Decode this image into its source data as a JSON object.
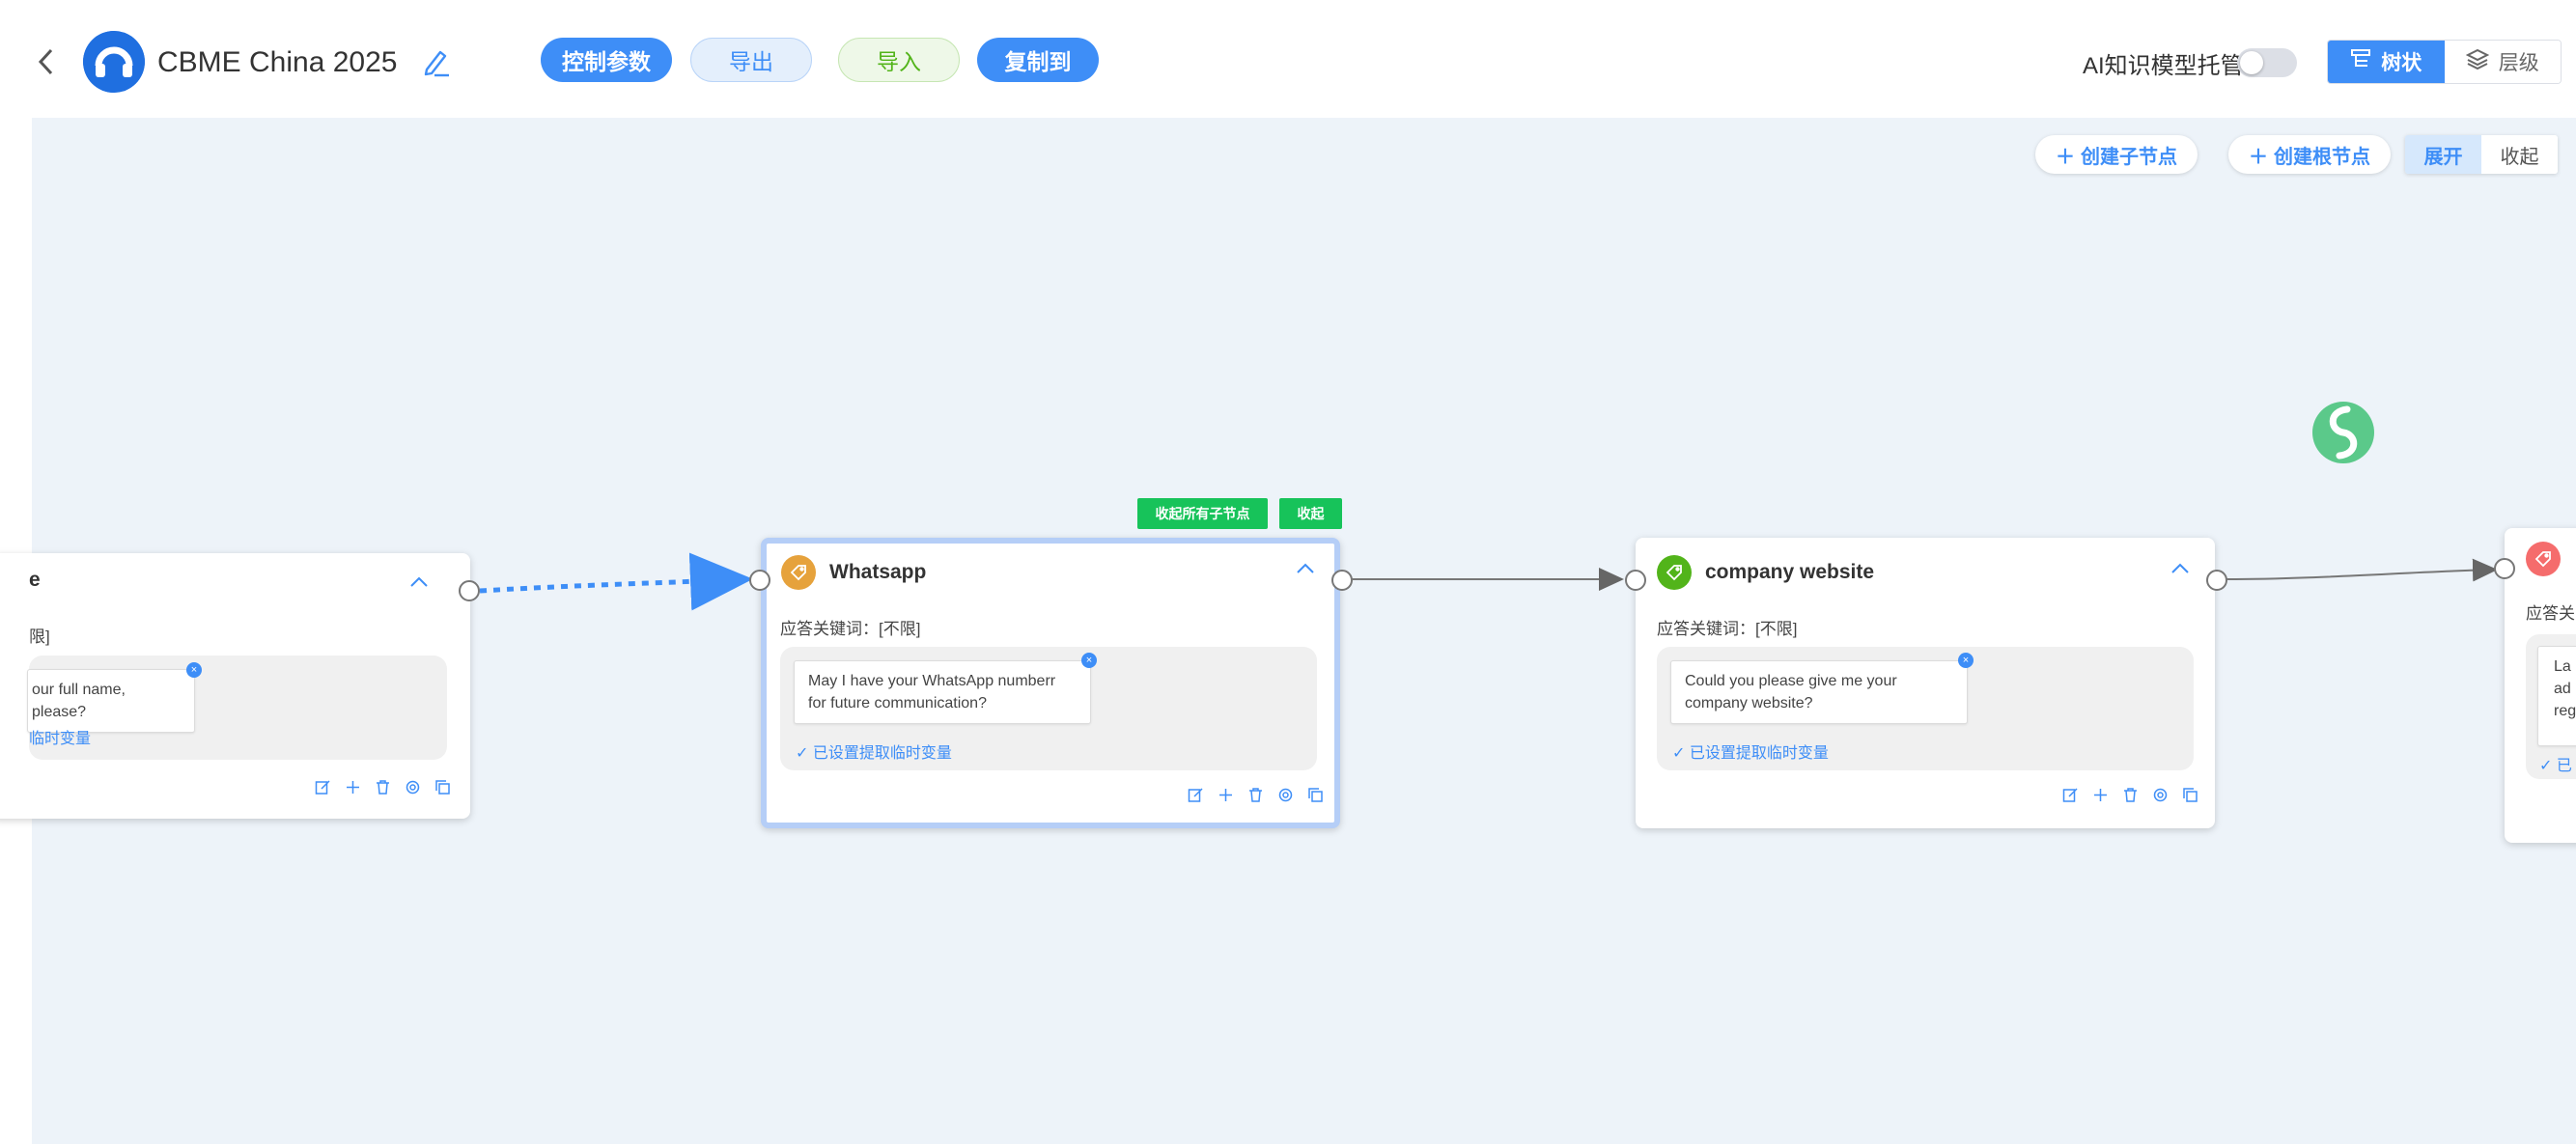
{
  "header": {
    "title": "CBME China 2025",
    "buttons": {
      "params": "控制参数",
      "export": "导出",
      "import": "导入",
      "copy": "复制到"
    },
    "ai_label": "AI知识模型托管",
    "ai_toggle_on": false,
    "view": {
      "tree": "树状",
      "level": "层级",
      "active": "tree"
    }
  },
  "toolbar": {
    "create_child": "创建子节点",
    "create_root": "创建根节点",
    "expand": "展开",
    "collapse": "收起"
  },
  "selected_controls": {
    "collapse_all_children": "收起所有子节点",
    "collapse": "收起"
  },
  "nodes": [
    {
      "title": "e",
      "keyword": "限]",
      "reply": "our full name, please?",
      "variable": "临时变量",
      "tag_color": "#e6a23c"
    },
    {
      "title": "Whatsapp",
      "keyword": "应答关键词：[不限]",
      "reply_line1": "May I have your WhatsApp numberr",
      "reply_line2": "for future communication?",
      "variable": "✓ 已设置提取临时变量",
      "tag_color": "#e6a23c"
    },
    {
      "title": "company website",
      "keyword": "应答关键词：[不限]",
      "reply_line1": "Could you please give me your",
      "reply_line2": "company website?",
      "variable": "✓ 已设置提取临时变量",
      "tag_color": "#52b41a"
    },
    {
      "title": "",
      "keyword": "应答关",
      "reply_line1": "La",
      "reply_line2": "ad",
      "reply_line3": "reg",
      "variable": "✓ 已",
      "tag_color": "#f56c6c"
    }
  ],
  "icons": {
    "back": "chevron-left-icon",
    "logo": "headset-logo-icon",
    "edit": "pencil-icon",
    "tree_view": "tree-view-icon",
    "level_view": "layers-icon",
    "tag": "tag-icon",
    "actions": [
      "edit-icon",
      "add-icon",
      "delete-icon",
      "settings-icon",
      "copy-icon"
    ]
  },
  "colors": {
    "primary": "#3e8ef7",
    "canvas": "#edf3f9",
    "green": "#17c35a",
    "selected_border": "#b5cef7"
  }
}
